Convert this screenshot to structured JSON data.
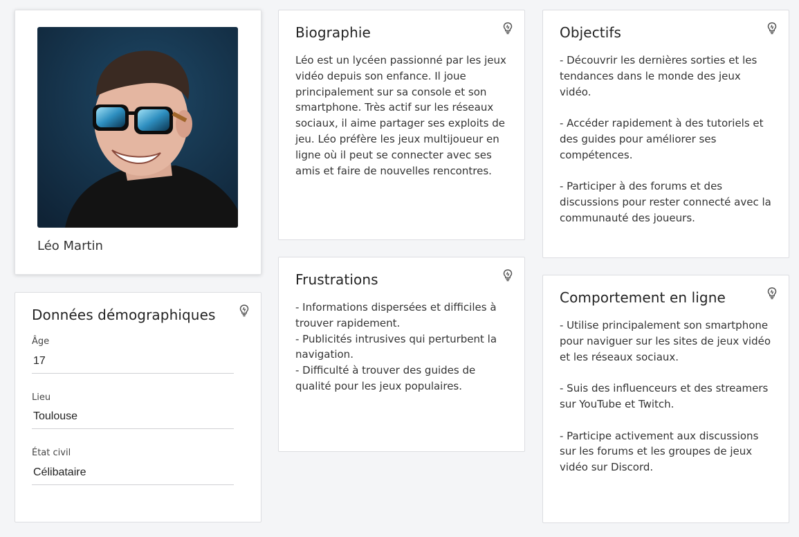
{
  "profile": {
    "name": "Léo Martin"
  },
  "demographics": {
    "title": "Données démographiques",
    "fields": [
      {
        "label": "Âge",
        "value": "17"
      },
      {
        "label": "Lieu",
        "value": "Toulouse"
      },
      {
        "label": "État civil",
        "value": "Célibataire"
      }
    ]
  },
  "biography": {
    "title": "Biographie",
    "text": "Léo est un lycéen passionné par les jeux vidéo depuis son enfance. Il joue principalement sur sa console et son smartphone. Très actif sur les réseaux sociaux, il aime partager ses exploits de jeu. Léo préfère les jeux multijoueur en ligne où il peut se connecter avec ses amis et faire de nouvelles rencontres."
  },
  "frustrations": {
    "title": "Frustrations",
    "items": [
      "- Informations dispersées et difficiles à trouver rapidement.",
      "- Publicités intrusives qui perturbent la navigation.",
      "- Difficulté à trouver des guides de qualité pour les jeux populaires."
    ]
  },
  "objectives": {
    "title": "Objectifs",
    "items": [
      "- Découvrir les dernières sorties et les tendances dans le monde des jeux vidéo.",
      "- Accéder rapidement à des tutoriels et des guides pour améliorer ses compétences.",
      "- Participer à des forums et des discussions pour rester connecté avec la communauté des joueurs."
    ]
  },
  "online_behavior": {
    "title": "Comportement en ligne",
    "items": [
      "- Utilise principalement son smartphone pour naviguer sur les sites de jeux vidéo et les réseaux sociaux.",
      "- Suis des influenceurs et des streamers sur YouTube et Twitch.",
      "- Participe activement aux discussions sur les forums et les groupes de jeux vidéo sur Discord."
    ]
  },
  "icons": {
    "hint": "lightbulb-icon",
    "avatar": "person-photo"
  }
}
